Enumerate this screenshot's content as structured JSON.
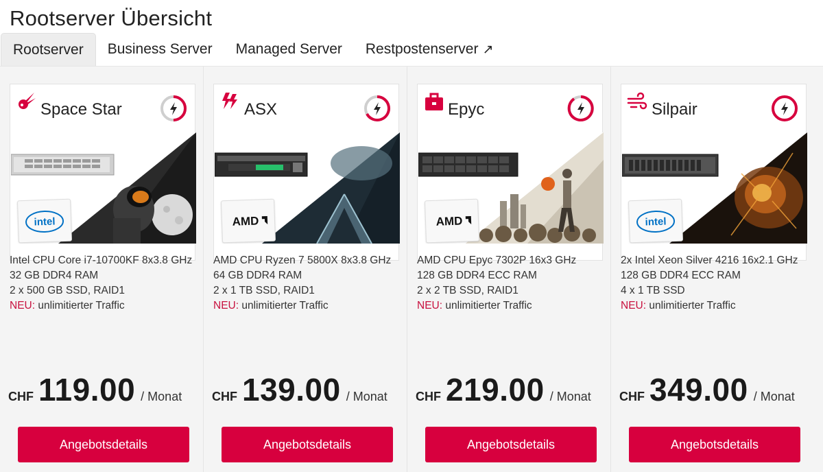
{
  "page": {
    "title": "Rootserver Übersicht"
  },
  "tabs": [
    {
      "label": "Rootserver",
      "active": true
    },
    {
      "label": "Business Server",
      "active": false
    },
    {
      "label": "Managed Server",
      "active": false
    },
    {
      "label": "Restpostenserver",
      "active": false,
      "icon": "external-link-icon",
      "icon_glyph": "↗"
    }
  ],
  "colors": {
    "accent": "#d7003e",
    "neu": "#c8103e",
    "panel_bg": "#f4f4f4"
  },
  "cards": [
    {
      "name": "Space Star",
      "type_icon": "comet-icon",
      "brand": "intel",
      "specs": [
        "Intel CPU Core i7-10700KF 8x3.8 GHz",
        "32 GB DDR4 RAM",
        "2 x 500 GB SSD, RAID1"
      ],
      "neu_label": "NEU:",
      "neu_text": " unlimitierter Traffic",
      "currency": "CHF",
      "price": "119.00",
      "period": "/ Monat",
      "button": "Angebotsdetails"
    },
    {
      "name": "ASX",
      "type_icon": "lightning-icon",
      "brand": "AMD",
      "specs": [
        "AMD CPU Ryzen 7 5800X 8x3.8 GHz",
        "64 GB DDR4 RAM",
        "2 x 1 TB SSD, RAID1"
      ],
      "neu_label": "NEU:",
      "neu_text": " unlimitierter Traffic",
      "currency": "CHF",
      "price": "139.00",
      "period": "/ Monat",
      "button": "Angebotsdetails"
    },
    {
      "name": "Epyc",
      "type_icon": "briefcase-icon",
      "brand": "AMD",
      "specs": [
        "AMD CPU Epyc 7302P 16x3 GHz",
        "128 GB DDR4 ECC RAM",
        "2 x 2 TB SSD, RAID1"
      ],
      "neu_label": "NEU:",
      "neu_text": " unlimitierter Traffic",
      "currency": "CHF",
      "price": "219.00",
      "period": "/ Monat",
      "button": "Angebotsdetails"
    },
    {
      "name": "Silpair",
      "type_icon": "wind-icon",
      "brand": "intel",
      "specs": [
        "2x Intel Xeon Silver 4216 16x2.1 GHz",
        "128 GB DDR4 ECC RAM",
        "4 x 1 TB SSD"
      ],
      "neu_label": "NEU:",
      "neu_text": " unlimitierter Traffic",
      "currency": "CHF",
      "price": "349.00",
      "period": "/ Monat",
      "button": "Angebotsdetails"
    }
  ]
}
